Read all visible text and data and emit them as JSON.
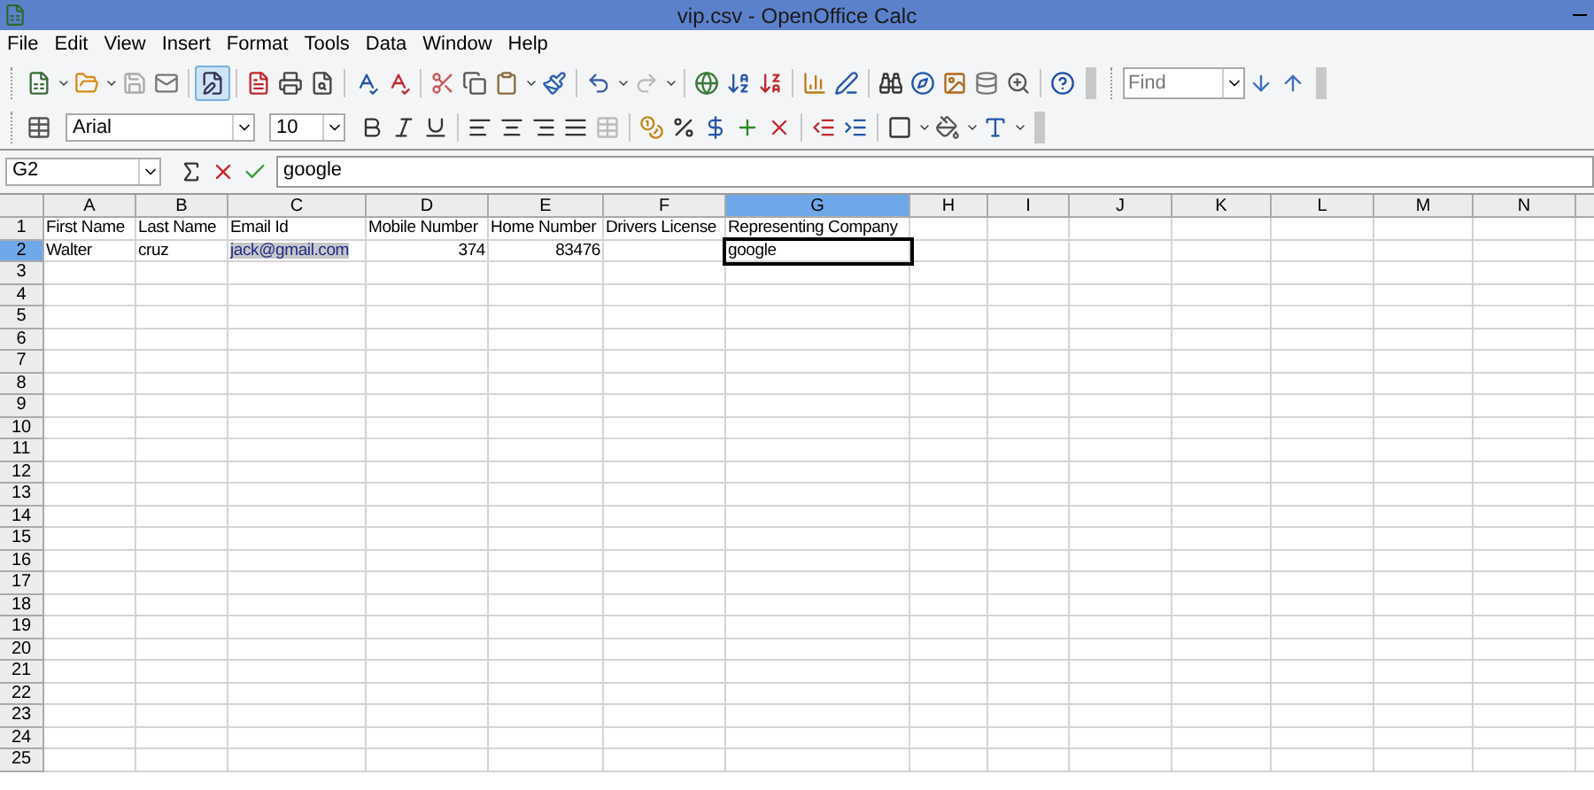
{
  "window": {
    "title": "vip.csv - OpenOffice Calc"
  },
  "menu": [
    "File",
    "Edit",
    "View",
    "Insert",
    "Format",
    "Tools",
    "Data",
    "Window",
    "Help"
  ],
  "find": {
    "placeholder": "Find"
  },
  "font": {
    "name": "Arial",
    "size": "10"
  },
  "formula_bar": {
    "name_box": "G2",
    "value": "google"
  },
  "columns": [
    {
      "label": "A",
      "selected": false
    },
    {
      "label": "B",
      "selected": false
    },
    {
      "label": "C",
      "selected": false
    },
    {
      "label": "D",
      "selected": false
    },
    {
      "label": "E",
      "selected": false
    },
    {
      "label": "F",
      "selected": false
    },
    {
      "label": "G",
      "selected": true
    },
    {
      "label": "H",
      "selected": false
    },
    {
      "label": "I",
      "selected": false
    },
    {
      "label": "J",
      "selected": false
    },
    {
      "label": "K",
      "selected": false
    },
    {
      "label": "L",
      "selected": false
    },
    {
      "label": "M",
      "selected": false
    },
    {
      "label": "N",
      "selected": false
    }
  ],
  "rows": [
    {
      "label": "1",
      "selected": false,
      "cells": [
        {
          "text": "First Name",
          "kind": "text"
        },
        {
          "text": "Last Name",
          "kind": "text"
        },
        {
          "text": "Email Id",
          "kind": "text"
        },
        {
          "text": "Mobile Number",
          "kind": "text"
        },
        {
          "text": "Home Number",
          "kind": "text"
        },
        {
          "text": "Drivers License",
          "kind": "text"
        },
        {
          "text": "Representing Company",
          "kind": "text"
        }
      ]
    },
    {
      "label": "2",
      "selected": true,
      "cells": [
        {
          "text": "Walter",
          "kind": "text"
        },
        {
          "text": "cruz",
          "kind": "text"
        },
        {
          "text": "jack@gmail.com",
          "kind": "link"
        },
        {
          "text": "374",
          "kind": "number"
        },
        {
          "text": "83476",
          "kind": "number"
        },
        {
          "text": "",
          "kind": "text"
        },
        {
          "text": "google",
          "kind": "text",
          "active": true
        }
      ]
    },
    {
      "label": "3",
      "selected": false
    },
    {
      "label": "4",
      "selected": false
    },
    {
      "label": "5",
      "selected": false
    },
    {
      "label": "6",
      "selected": false
    },
    {
      "label": "7",
      "selected": false
    },
    {
      "label": "8",
      "selected": false
    },
    {
      "label": "9",
      "selected": false
    },
    {
      "label": "10",
      "selected": false
    },
    {
      "label": "11",
      "selected": false
    },
    {
      "label": "12",
      "selected": false
    },
    {
      "label": "13",
      "selected": false
    },
    {
      "label": "14",
      "selected": false
    },
    {
      "label": "15",
      "selected": false
    },
    {
      "label": "16",
      "selected": false
    },
    {
      "label": "17",
      "selected": false
    },
    {
      "label": "18",
      "selected": false
    },
    {
      "label": "19",
      "selected": false
    },
    {
      "label": "20",
      "selected": false
    },
    {
      "label": "21",
      "selected": false
    },
    {
      "label": "22",
      "selected": false
    },
    {
      "label": "23",
      "selected": false
    },
    {
      "label": "24",
      "selected": false
    },
    {
      "label": "25",
      "selected": false
    }
  ]
}
